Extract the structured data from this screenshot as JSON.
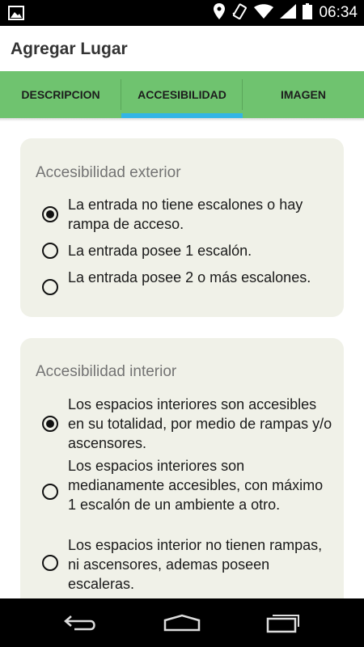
{
  "status_bar": {
    "time": "06:34",
    "icons": [
      "image-icon",
      "location-icon",
      "vibrate-icon",
      "wifi-icon",
      "signal-icon",
      "battery-icon"
    ]
  },
  "action_bar": {
    "title": "Agregar Lugar"
  },
  "tabs": [
    {
      "label": "DESCRIPCION",
      "active": false
    },
    {
      "label": "ACCESIBILIDAD",
      "active": true
    },
    {
      "label": "IMAGEN",
      "active": false
    }
  ],
  "exterior": {
    "title": "Accesibilidad exterior",
    "options": [
      {
        "label": "La entrada no tiene escalones o hay rampa de acceso.",
        "checked": true
      },
      {
        "label": "La entrada posee 1 escalón.",
        "checked": false
      },
      {
        "label": "La entrada posee 2 o más escalones.",
        "checked": false
      }
    ]
  },
  "interior": {
    "title": "Accesibilidad interior",
    "options": [
      {
        "label": "Los espacios interiores son accesibles en su totalidad, por medio de rampas y/o ascensores.",
        "checked": true
      },
      {
        "label": "Los espacios interiores son medianamente accesibles, con máximo 1 escalón de un ambiente a otro.",
        "checked": false
      },
      {
        "label": "Los espacios interior no tienen rampas, ni ascensores, ademas poseen escaleras.",
        "checked": false
      }
    ]
  },
  "colors": {
    "tab_background": "#6fc36f",
    "tab_indicator": "#33b5e5",
    "card_background": "#f0f1e8"
  },
  "nav_bar": {
    "icons": [
      "back-icon",
      "home-icon",
      "recent-apps-icon"
    ]
  }
}
